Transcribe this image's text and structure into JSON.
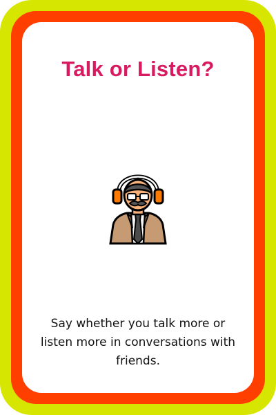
{
  "card": {
    "title": "Talk or Listen?",
    "prompt": "Say whether you talk more or listen more in conversations with friends.",
    "illustration_icon": "man-with-headphones-icon"
  },
  "colors": {
    "outer_border": "#d7e600",
    "inner_border": "#ff3f00",
    "title": "#d81b60",
    "text": "#111111",
    "background": "#ffffff"
  }
}
